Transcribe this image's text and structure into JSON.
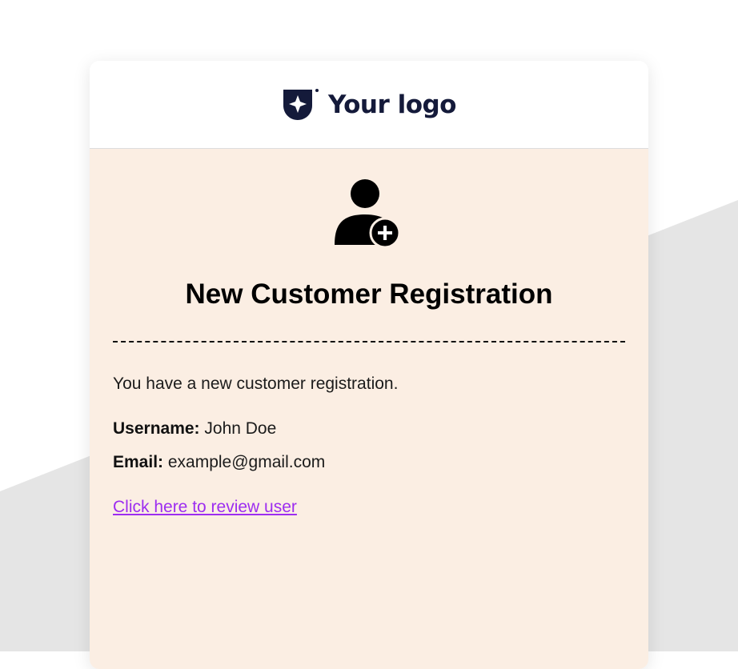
{
  "logo": {
    "text": "Your logo",
    "icon": "shield-sparkle-icon",
    "color": "#141a3a"
  },
  "email": {
    "icon": "user-add-icon",
    "title": "New Customer Registration",
    "intro": "You have a new customer registration.",
    "username_label": "Username:",
    "username_value": "John Doe",
    "email_label": "Email:",
    "email_value": "example@gmail.com",
    "review_link": "Click here to review user"
  },
  "colors": {
    "body_background": "#fbeee3",
    "link": "#9d2df0",
    "backdrop_shape": "#e5e5e5"
  }
}
